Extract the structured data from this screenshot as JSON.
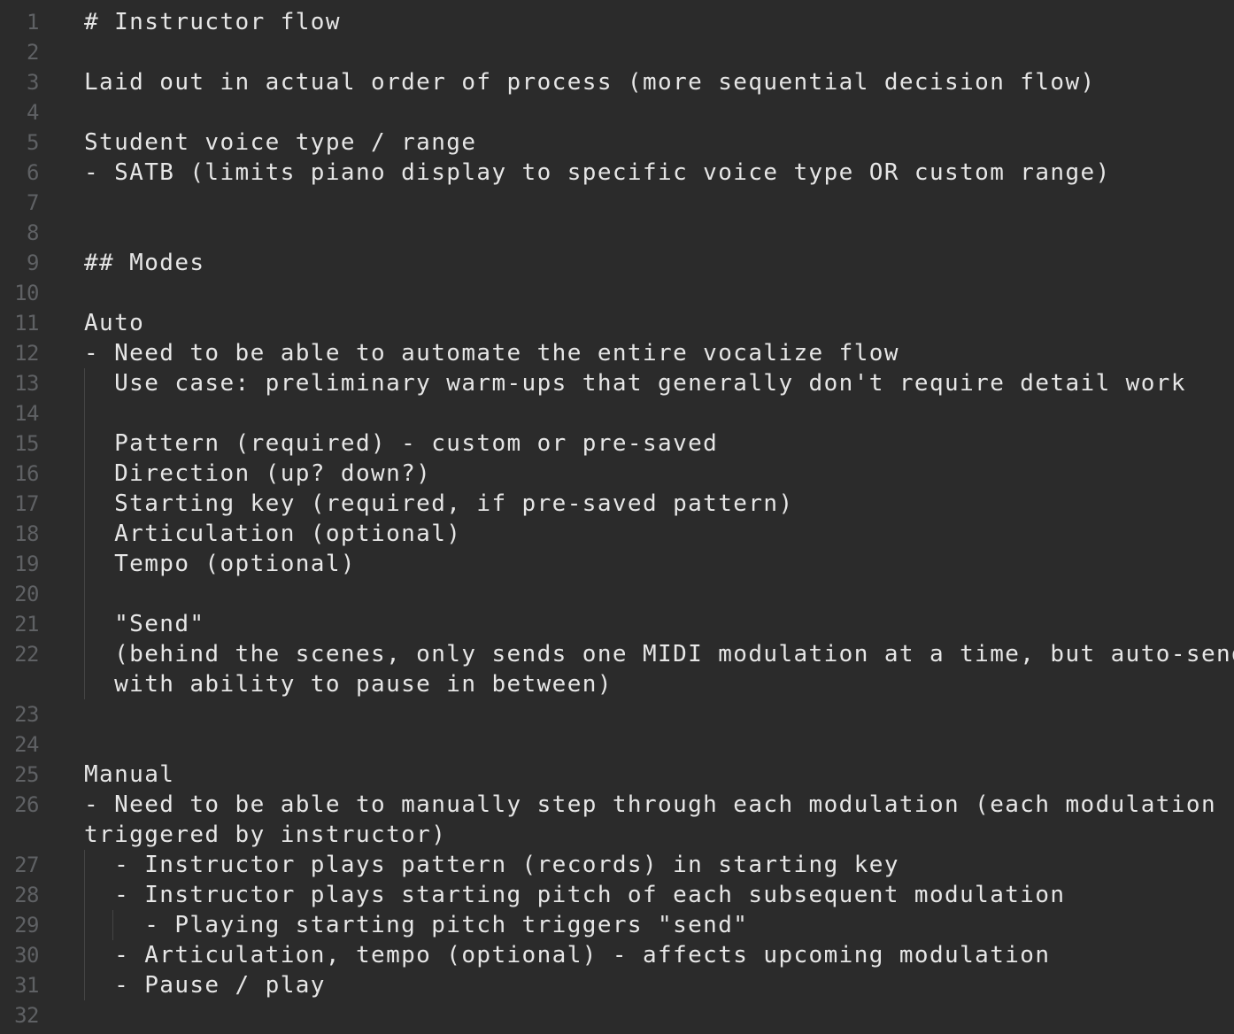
{
  "editor": {
    "lines": [
      {
        "n": "1",
        "text": "# Instructor flow"
      },
      {
        "n": "2",
        "text": ""
      },
      {
        "n": "3",
        "text": "Laid out in actual order of process (more sequential decision flow)"
      },
      {
        "n": "4",
        "text": ""
      },
      {
        "n": "5",
        "text": "Student voice type / range"
      },
      {
        "n": "6",
        "text": "- SATB (limits piano display to specific voice type OR custom range)"
      },
      {
        "n": "7",
        "text": ""
      },
      {
        "n": "8",
        "text": ""
      },
      {
        "n": "9",
        "text": "## Modes"
      },
      {
        "n": "10",
        "text": ""
      },
      {
        "n": "11",
        "text": "Auto"
      },
      {
        "n": "12",
        "text": "- Need to be able to automate the entire vocalize flow"
      },
      {
        "n": "13",
        "text": "  Use case: preliminary warm-ups that generally don't require detail work"
      },
      {
        "n": "14",
        "text": ""
      },
      {
        "n": "15",
        "text": "  Pattern (required) - custom or pre-saved"
      },
      {
        "n": "16",
        "text": "  Direction (up? down?)"
      },
      {
        "n": "17",
        "text": "  Starting key (required, if pre-saved pattern)"
      },
      {
        "n": "18",
        "text": "  Articulation (optional)"
      },
      {
        "n": "19",
        "text": "  Tempo (optional)"
      },
      {
        "n": "20",
        "text": ""
      },
      {
        "n": "21",
        "text": "  \"Send\""
      },
      {
        "n": "22",
        "text": "  (behind the scenes, only sends one MIDI modulation at a time, but auto-sends,"
      },
      {
        "n": "",
        "text": "  with ability to pause in between)"
      },
      {
        "n": "23",
        "text": ""
      },
      {
        "n": "24",
        "text": ""
      },
      {
        "n": "25",
        "text": "Manual"
      },
      {
        "n": "26",
        "text": "- Need to be able to manually step through each modulation (each modulation"
      },
      {
        "n": "",
        "text": "triggered by instructor)"
      },
      {
        "n": "27",
        "text": "  - Instructor plays pattern (records) in starting key"
      },
      {
        "n": "28",
        "text": "  - Instructor plays starting pitch of each subsequent modulation"
      },
      {
        "n": "29",
        "text": "    - Playing starting pitch triggers \"send\""
      },
      {
        "n": "30",
        "text": "  - Articulation, tempo (optional) - affects upcoming modulation"
      },
      {
        "n": "31",
        "text": "  - Pause / play"
      },
      {
        "n": "32",
        "text": ""
      }
    ]
  }
}
